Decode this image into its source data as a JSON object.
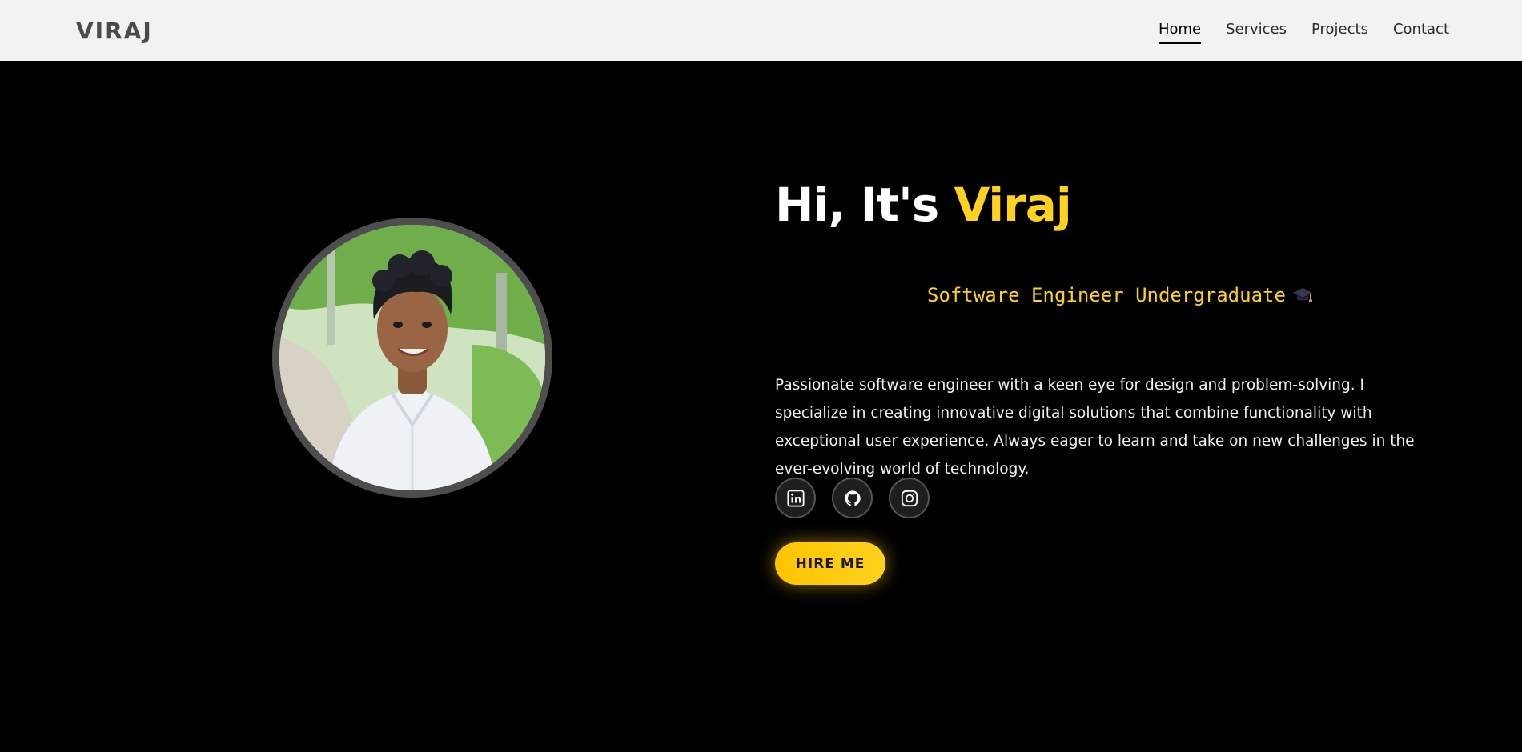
{
  "header": {
    "logo": "VIRAJ",
    "nav": [
      {
        "label": "Home",
        "active": true
      },
      {
        "label": "Services",
        "active": false
      },
      {
        "label": "Projects",
        "active": false
      },
      {
        "label": "Contact",
        "active": false
      }
    ]
  },
  "hero": {
    "greeting": "Hi, It's",
    "name": "Viraj",
    "role": "Software Engineer Undergraduate",
    "role_icon": "graduation-cap-icon",
    "bio": "Passionate software engineer with a keen eye for design and problem-solving. I specialize in creating innovative digital solutions that combine functionality with exceptional user experience. Always eager to learn and take on new challenges in the ever-evolving world of technology.",
    "socials": [
      {
        "icon": "linkedin-icon"
      },
      {
        "icon": "github-icon"
      },
      {
        "icon": "instagram-icon"
      }
    ],
    "cta_label": "HIRE ME"
  },
  "colors": {
    "accent": "#ffd21f",
    "background": "#000000",
    "header_bg": "#f2f2f2",
    "logo": "#4a4a4a"
  }
}
